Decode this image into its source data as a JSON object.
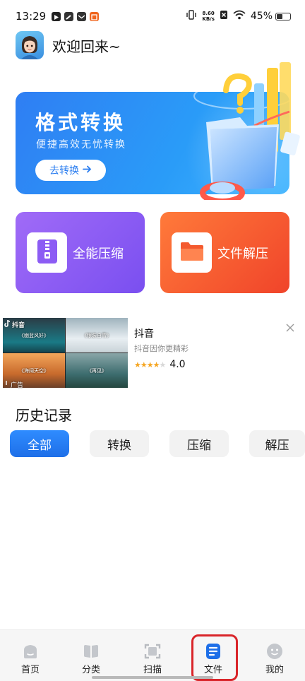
{
  "status_bar": {
    "time": "13:29",
    "net_speed_value": "8.60",
    "net_speed_unit": "KB/s",
    "battery": "45%",
    "battery_level": 0.45,
    "notification_icons": [
      "play-icon",
      "link-icon",
      "mail-icon",
      "app-badge-icon"
    ]
  },
  "header": {
    "welcome": "欢迎回来~"
  },
  "banner": {
    "title": "格式转换",
    "subtitle": "便捷高效无忧转换",
    "button": "去转换",
    "button_icon": "arrow-right-icon",
    "colors": {
      "start": "#2f7ef3",
      "end": "#3fb4ff"
    }
  },
  "tools": {
    "compress": {
      "label": "全能压缩",
      "icon": "zip-file-icon",
      "color": "#8c5cf4"
    },
    "decompress": {
      "label": "文件解压",
      "icon": "folder-icon",
      "color": "#f45a2e"
    }
  },
  "ad": {
    "brand": "抖音",
    "title": "抖音",
    "description": "抖音因你更精彩",
    "rating": "4.0",
    "rating_value": 4.0,
    "tag": "广告",
    "thumb_captions": [
      "《幽蓝风好》",
      "《银装白雪》",
      "《海阔天空》",
      "《再见》"
    ]
  },
  "history": {
    "title": "历史记录",
    "tabs": [
      {
        "label": "全部",
        "active": true
      },
      {
        "label": "转换",
        "active": false
      },
      {
        "label": "压缩",
        "active": false
      },
      {
        "label": "解压",
        "active": false
      }
    ]
  },
  "bottom_nav": {
    "items": [
      {
        "label": "首页",
        "icon": "home-icon"
      },
      {
        "label": "分类",
        "icon": "category-icon"
      },
      {
        "label": "扫描",
        "icon": "scan-icon"
      },
      {
        "label": "文件",
        "icon": "file-icon",
        "active": true
      },
      {
        "label": "我的",
        "icon": "profile-icon"
      }
    ],
    "accent": "#1e6fe8",
    "highlight_color": "#d9252a"
  }
}
